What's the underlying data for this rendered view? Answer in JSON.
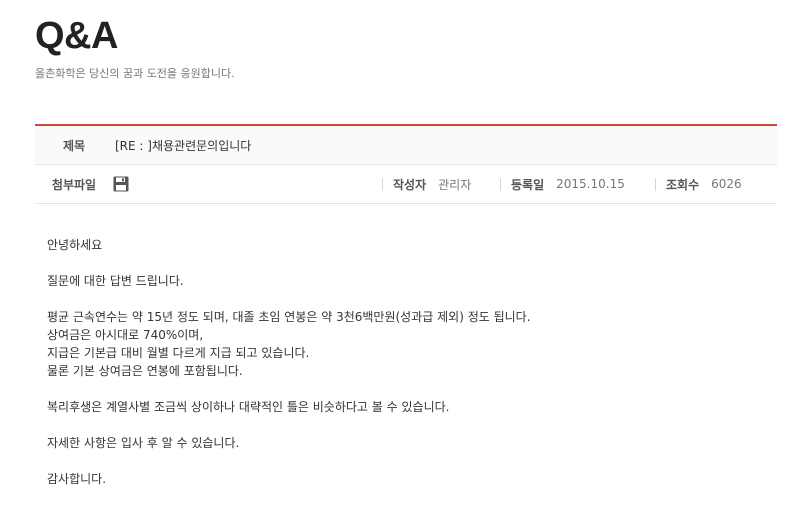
{
  "page": {
    "title": "Q&A",
    "subtitle": "올촌화학은 당신의 꿈과 도전을 응원합니다."
  },
  "post": {
    "subject_label": "제목",
    "subject": "[RE : ]채용관련문의입니다",
    "attachment_label": "첨부파일",
    "attachment_icon": "floppy-disk-icon",
    "author_label": "작성자",
    "author": "관리자",
    "date_label": "등록일",
    "date": "2015.10.15",
    "views_label": "조회수",
    "views": "6026"
  },
  "body": {
    "p1": "안녕하세요",
    "p2": "질문에 대한 답변 드립니다.",
    "p3": "평균 근속연수는 약 15년 정도 되며, 대졸 초임 연봉은 약 3천6백만원(성과급 제외) 정도 됩니다.",
    "p4": "상여금은 아시대로 740%이며,",
    "p5": "지급은 기본급 대비 월별 다르게 지급 되고 있습니다.",
    "p6": "물론 기본 상여금은 연봉에 포함됩니다.",
    "p7": "복리후생은 계열사별 조금씩 상이하나 대략적인 틀은 비슷하다고 볼 수 있습니다.",
    "p8": "자세한 사항은 입사 후 알 수 있습니다.",
    "p9": "감사합니다."
  },
  "colors": {
    "accent": "#c94a35"
  }
}
